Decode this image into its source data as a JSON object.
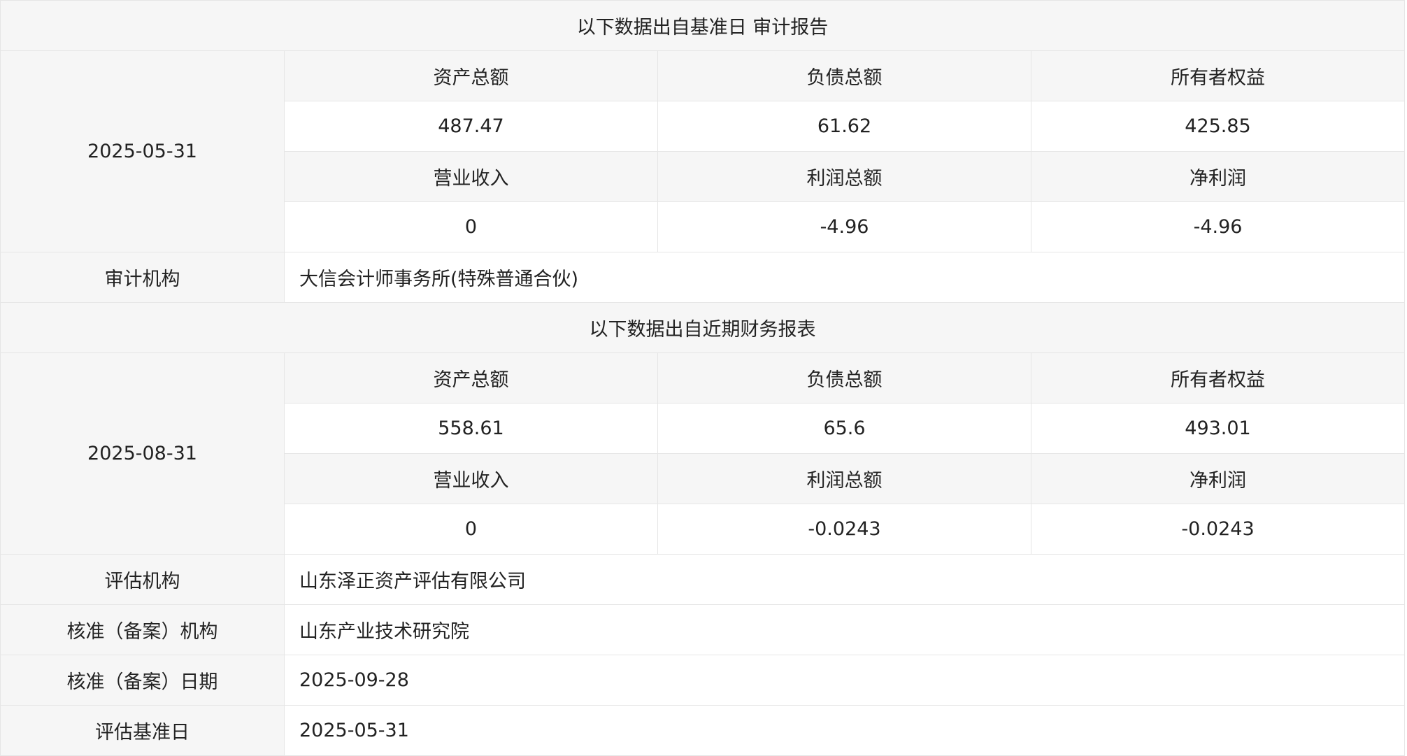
{
  "sections": [
    {
      "title": "以下数据出自基准日 审计报告",
      "date": "2025-05-31",
      "row1_labels": [
        "资产总额",
        "负债总额",
        "所有者权益"
      ],
      "row1_values": [
        "487.47",
        "61.62",
        "425.85"
      ],
      "row2_labels": [
        "营业收入",
        "利润总额",
        "净利润"
      ],
      "row2_values": [
        "0",
        "-4.96",
        "-4.96"
      ],
      "org": {
        "label": "审计机构",
        "value": "大信会计师事务所(特殊普通合伙)"
      }
    },
    {
      "title": "以下数据出自近期财务报表",
      "date": "2025-08-31",
      "row1_labels": [
        "资产总额",
        "负债总额",
        "所有者权益"
      ],
      "row1_values": [
        "558.61",
        "65.6",
        "493.01"
      ],
      "row2_labels": [
        "营业收入",
        "利润总额",
        "净利润"
      ],
      "row2_values": [
        "0",
        "-0.0243",
        "-0.0243"
      ]
    }
  ],
  "info_rows": [
    {
      "label": "评估机构",
      "value": "山东泽正资产评估有限公司"
    },
    {
      "label": "核准（备案）机构",
      "value": "山东产业技术研究院"
    },
    {
      "label": "核准（备案）日期",
      "value": "2025-09-28"
    },
    {
      "label": "评估基准日",
      "value": "2025-05-31"
    }
  ]
}
